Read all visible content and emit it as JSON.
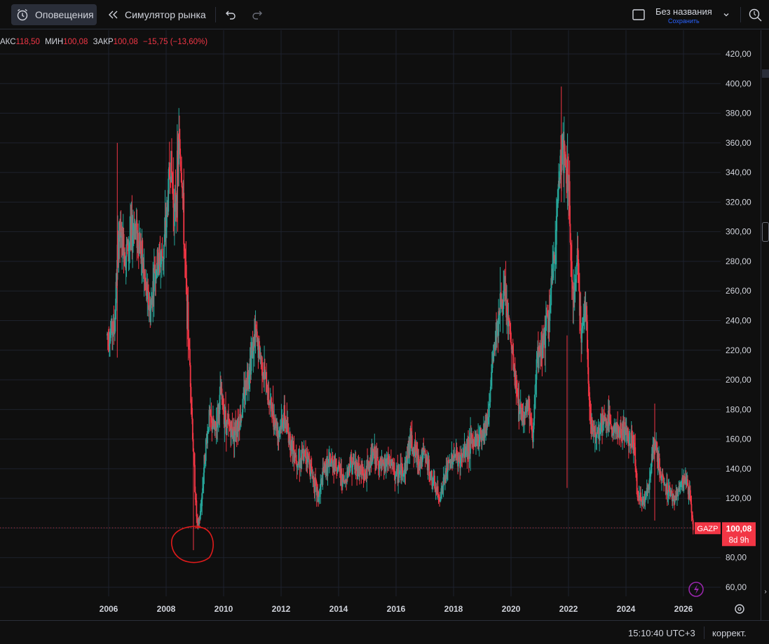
{
  "toolbar": {
    "alerts_label": "Оповещения",
    "replay_label": "Симулятор рынка",
    "layout_name": "Без названия",
    "save_label": "Сохранить"
  },
  "legend": {
    "max_key": "АКС",
    "max_val": "118,50",
    "min_key": "МИН",
    "min_val": "100,08",
    "close_key": "ЗАКР",
    "close_val": "100,08",
    "change": "−15,75 (−13,60%)"
  },
  "price_tag": {
    "symbol": "GAZP",
    "price": "100,08",
    "countdown": "8d 9h",
    "color": "#f23645"
  },
  "status": {
    "clock": "15:10:40 UTC+3",
    "adjust": "коррект."
  },
  "colors": {
    "up": "#26a69a",
    "down": "#f23645",
    "grid": "#1e222d",
    "annotation": "#e01b1b"
  },
  "chart_data": {
    "type": "candlestick",
    "symbol": "GAZP",
    "xlim": [
      2005.0,
      2027.0
    ],
    "ylim": [
      52,
      428
    ],
    "x_ticks": [
      "2006",
      "2008",
      "2010",
      "2012",
      "2014",
      "2016",
      "2018",
      "2020",
      "2022",
      "2024",
      "2026"
    ],
    "y_ticks": [
      "420,00",
      "400,00",
      "380,00",
      "360,00",
      "340,00",
      "320,00",
      "300,00",
      "280,00",
      "260,00",
      "240,00",
      "220,00",
      "200,00",
      "180,00",
      "160,00",
      "140,00",
      "120,00",
      "100,00",
      "80,00",
      "60,00"
    ],
    "last_price": 100.08,
    "price_path": [
      [
        2005.95,
        230
      ],
      [
        2006.2,
        235
      ],
      [
        2006.35,
        300
      ],
      [
        2006.6,
        285
      ],
      [
        2006.9,
        305
      ],
      [
        2007.1,
        290
      ],
      [
        2007.3,
        260
      ],
      [
        2007.45,
        245
      ],
      [
        2007.6,
        275
      ],
      [
        2007.9,
        285
      ],
      [
        2008.0,
        305
      ],
      [
        2008.15,
        350
      ],
      [
        2008.3,
        310
      ],
      [
        2008.45,
        360
      ],
      [
        2008.55,
        340
      ],
      [
        2008.65,
        280
      ],
      [
        2008.75,
        240
      ],
      [
        2008.85,
        200
      ],
      [
        2008.95,
        150
      ],
      [
        2009.05,
        110
      ],
      [
        2009.1,
        100
      ],
      [
        2009.2,
        110
      ],
      [
        2009.35,
        150
      ],
      [
        2009.5,
        175
      ],
      [
        2009.7,
        165
      ],
      [
        2009.9,
        190
      ],
      [
        2010.1,
        170
      ],
      [
        2010.35,
        165
      ],
      [
        2010.6,
        175
      ],
      [
        2010.8,
        200
      ],
      [
        2011.1,
        230
      ],
      [
        2011.35,
        210
      ],
      [
        2011.6,
        185
      ],
      [
        2011.9,
        165
      ],
      [
        2012.1,
        175
      ],
      [
        2012.3,
        160
      ],
      [
        2012.6,
        145
      ],
      [
        2012.9,
        150
      ],
      [
        2013.1,
        135
      ],
      [
        2013.3,
        120
      ],
      [
        2013.5,
        140
      ],
      [
        2013.8,
        145
      ],
      [
        2014.0,
        140
      ],
      [
        2014.2,
        130
      ],
      [
        2014.4,
        145
      ],
      [
        2014.7,
        140
      ],
      [
        2014.9,
        135
      ],
      [
        2015.2,
        150
      ],
      [
        2015.5,
        140
      ],
      [
        2015.8,
        145
      ],
      [
        2016.0,
        135
      ],
      [
        2016.3,
        140
      ],
      [
        2016.5,
        160
      ],
      [
        2016.8,
        145
      ],
      [
        2017.0,
        150
      ],
      [
        2017.2,
        135
      ],
      [
        2017.5,
        120
      ],
      [
        2017.8,
        140
      ],
      [
        2018.0,
        150
      ],
      [
        2018.2,
        145
      ],
      [
        2018.5,
        155
      ],
      [
        2018.8,
        160
      ],
      [
        2019.0,
        165
      ],
      [
        2019.2,
        175
      ],
      [
        2019.4,
        220
      ],
      [
        2019.6,
        250
      ],
      [
        2019.8,
        255
      ],
      [
        2020.0,
        225
      ],
      [
        2020.2,
        190
      ],
      [
        2020.4,
        175
      ],
      [
        2020.6,
        185
      ],
      [
        2020.75,
        160
      ],
      [
        2020.9,
        210
      ],
      [
        2021.1,
        225
      ],
      [
        2021.3,
        240
      ],
      [
        2021.5,
        280
      ],
      [
        2021.65,
        330
      ],
      [
        2021.75,
        355
      ],
      [
        2021.85,
        350
      ],
      [
        2022.0,
        330
      ],
      [
        2022.1,
        275
      ],
      [
        2022.2,
        245
      ],
      [
        2022.3,
        290
      ],
      [
        2022.45,
        230
      ],
      [
        2022.6,
        250
      ],
      [
        2022.75,
        175
      ],
      [
        2022.9,
        162
      ],
      [
        2023.1,
        168
      ],
      [
        2023.3,
        172
      ],
      [
        2023.5,
        170
      ],
      [
        2023.7,
        165
      ],
      [
        2023.9,
        166
      ],
      [
        2024.1,
        163
      ],
      [
        2024.3,
        155
      ],
      [
        2024.4,
        120
      ],
      [
        2024.6,
        118
      ],
      [
        2024.8,
        130
      ],
      [
        2025.0,
        160
      ],
      [
        2025.1,
        145
      ],
      [
        2025.3,
        130
      ],
      [
        2025.5,
        125
      ],
      [
        2025.7,
        120
      ],
      [
        2025.9,
        128
      ],
      [
        2026.1,
        132
      ],
      [
        2026.25,
        118
      ],
      [
        2026.35,
        100.08
      ]
    ],
    "wick_seeds": [
      [
        2006.3,
        360,
        215
      ],
      [
        2008.4,
        368,
        300
      ],
      [
        2008.95,
        160,
        85
      ],
      [
        2021.75,
        398,
        320
      ],
      [
        2021.95,
        230,
        127
      ],
      [
        2025.0,
        184,
        105
      ]
    ]
  }
}
